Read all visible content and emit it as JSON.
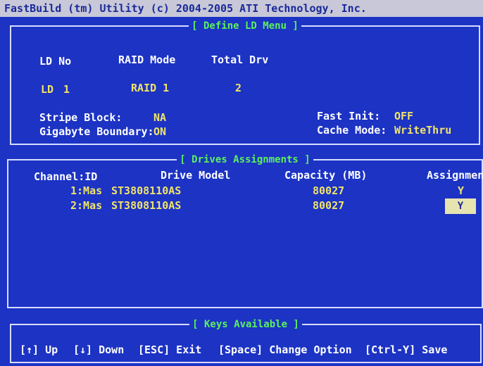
{
  "window": {
    "title": "FastBuild (tm) Utility (c) 2004-2005 ATI Technology, Inc."
  },
  "define_ld": {
    "title": "[ Define LD Menu ]",
    "headers": {
      "ld_no": "LD No",
      "raid_mode": "RAID Mode",
      "total_drv": "Total Drv"
    },
    "row": {
      "ld_no_label": "LD",
      "ld_no_value": "1",
      "raid_mode": "RAID 1",
      "total_drv": "2"
    },
    "stripe_block_label": "Stripe Block:",
    "stripe_block_value": "NA",
    "gigabyte_boundary_label": "Gigabyte Boundary:",
    "gigabyte_boundary_value": "ON",
    "fast_init_label": "Fast Init:",
    "fast_init_value": "OFF",
    "cache_mode_label": "Cache Mode:",
    "cache_mode_value": "WriteThru"
  },
  "drives": {
    "title": "[ Drives Assignments ]",
    "headers": {
      "channel_id": "Channel:ID",
      "drive_model": "Drive Model",
      "capacity": "Capacity (MB)",
      "assignment": "Assignment"
    },
    "rows": [
      {
        "channel": "1:Mas",
        "model": "ST3808110AS",
        "capacity": "80027",
        "assignment": "Y"
      },
      {
        "channel": "2:Mas",
        "model": "ST3808110AS",
        "capacity": "80027",
        "assignment": "Y"
      }
    ]
  },
  "keys": {
    "title": "[ Keys Available ]",
    "up": "[↑] Up",
    "down": "[↓] Down",
    "esc": "[ESC] Exit",
    "space": "[Space] Change Option",
    "save": "[Ctrl-Y] Save"
  },
  "colors": {
    "background": "#1c33c4",
    "title_green": "#5cf05c",
    "value_yellow": "#f0e46a",
    "selected_bg": "#e8e4b0"
  }
}
